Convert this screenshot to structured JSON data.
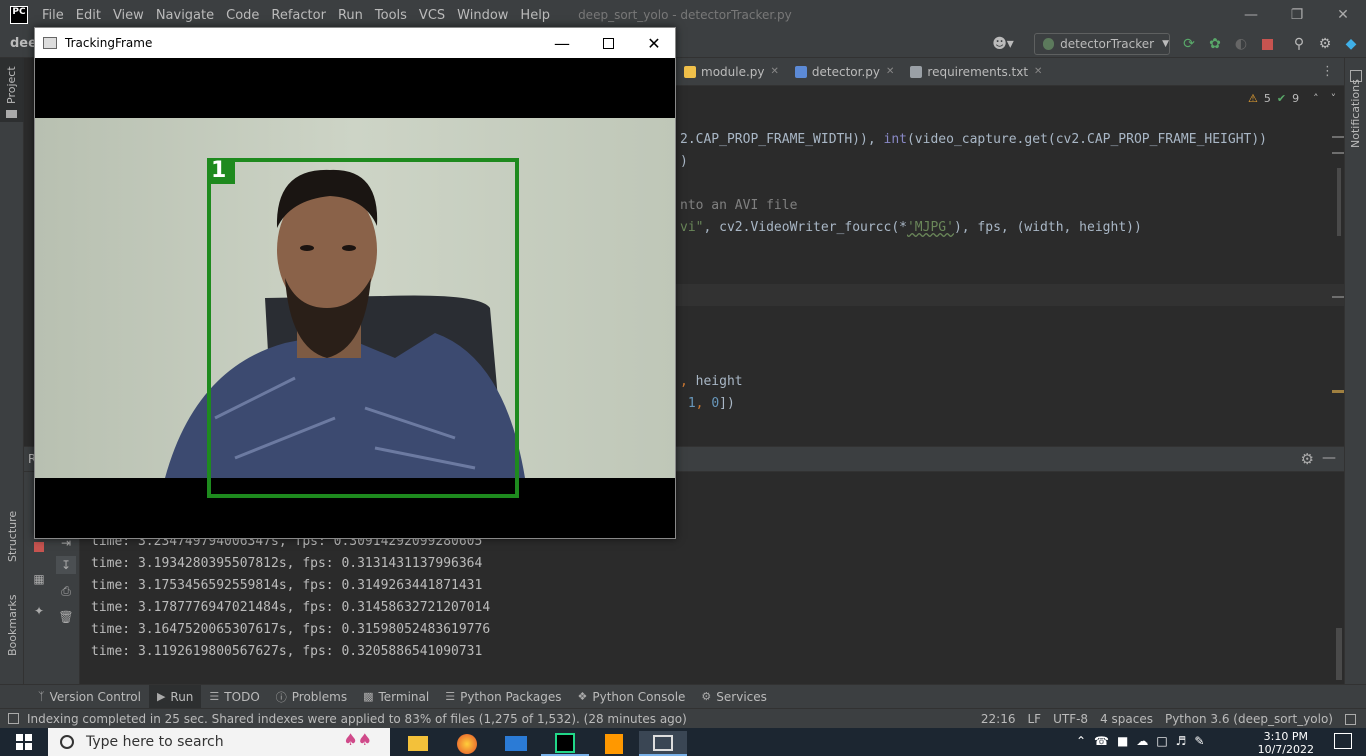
{
  "menubar": {
    "logo": "PC",
    "items": [
      "File",
      "Edit",
      "View",
      "Navigate",
      "Code",
      "Refactor",
      "Run",
      "Tools",
      "VCS",
      "Window",
      "Help"
    ],
    "window_title": "deep_sort_yolo - detectorTracker.py"
  },
  "toolbar": {
    "project_abbrev": "dee",
    "run_config": "detectorTracker"
  },
  "left_stripe": {
    "project_label": "Project",
    "structure_label": "Structure",
    "bookmarks_label": "Bookmarks"
  },
  "right_stripe": {
    "notifications_label": "Notifications"
  },
  "tabs": [
    {
      "label": "module.py",
      "color": "#f0c04a"
    },
    {
      "label": "detector.py",
      "color": "#5c8ad6"
    },
    {
      "label": "requirements.txt",
      "color": "#9aa0a6"
    }
  ],
  "inspections": {
    "warnings": "5",
    "weak_warnings": "9"
  },
  "editor": {
    "line1_a": "2.CAP_PROP_FRAME_WIDTH)), ",
    "line1_b": "int",
    "line1_c": "(video_capture.get(cv2.CAP_PROP_FRAME_HEIGHT))",
    "line2": ")",
    "line3": "nto an AVI file",
    "line4_a": "vi\"",
    "line4_b": ", cv2.VideoWriter_fourcc(*",
    "line4_c": "'MJPG'",
    "line4_d": "), fps, (width, height))",
    "line5_a": ", ",
    "line5_b": "height",
    "line6_a": " ",
    "line6_b": "1",
    "line6_c": ", ",
    "line6_d": "0",
    "line6_e": "])"
  },
  "console": {
    "lines": [
      "time: 3.234749794006347s, fps: 0.30914292099280605",
      "time: 3.1934280395507812s, fps: 0.3131431137996364",
      "time: 3.1753456592559814s, fps: 0.3149263441871431",
      "time: 3.1787776947021484s, fps: 0.31458632721207014",
      "time: 3.1647520065307617s, fps: 0.31598052483619776",
      "time: 3.1192619800567627s, fps: 0.3205886541090731"
    ],
    "run_label_short": "R"
  },
  "bottom_tools": [
    {
      "label": "Version Control",
      "icon": "branch-icon"
    },
    {
      "label": "Run",
      "icon": "play-icon"
    },
    {
      "label": "TODO",
      "icon": "list-icon"
    },
    {
      "label": "Problems",
      "icon": "info-icon"
    },
    {
      "label": "Terminal",
      "icon": "terminal-icon"
    },
    {
      "label": "Python Packages",
      "icon": "layers-icon"
    },
    {
      "label": "Python Console",
      "icon": "python-icon"
    },
    {
      "label": "Services",
      "icon": "services-icon"
    }
  ],
  "status": {
    "message": "Indexing completed in 25 sec. Shared indexes were applied to 83% of files (1,275 of 1,532). (28 minutes ago)",
    "position": "22:16",
    "line_sep": "LF",
    "encoding": "UTF-8",
    "indent": "4 spaces",
    "interpreter": "Python 3.6 (deep_sort_yolo)"
  },
  "taskbar": {
    "search_placeholder": "Type here to search",
    "time": "3:10 PM",
    "date": "10/7/2022"
  },
  "tracking_window": {
    "title": "TrackingFrame",
    "track_id": "1",
    "box_color": "#1e8a1e"
  }
}
